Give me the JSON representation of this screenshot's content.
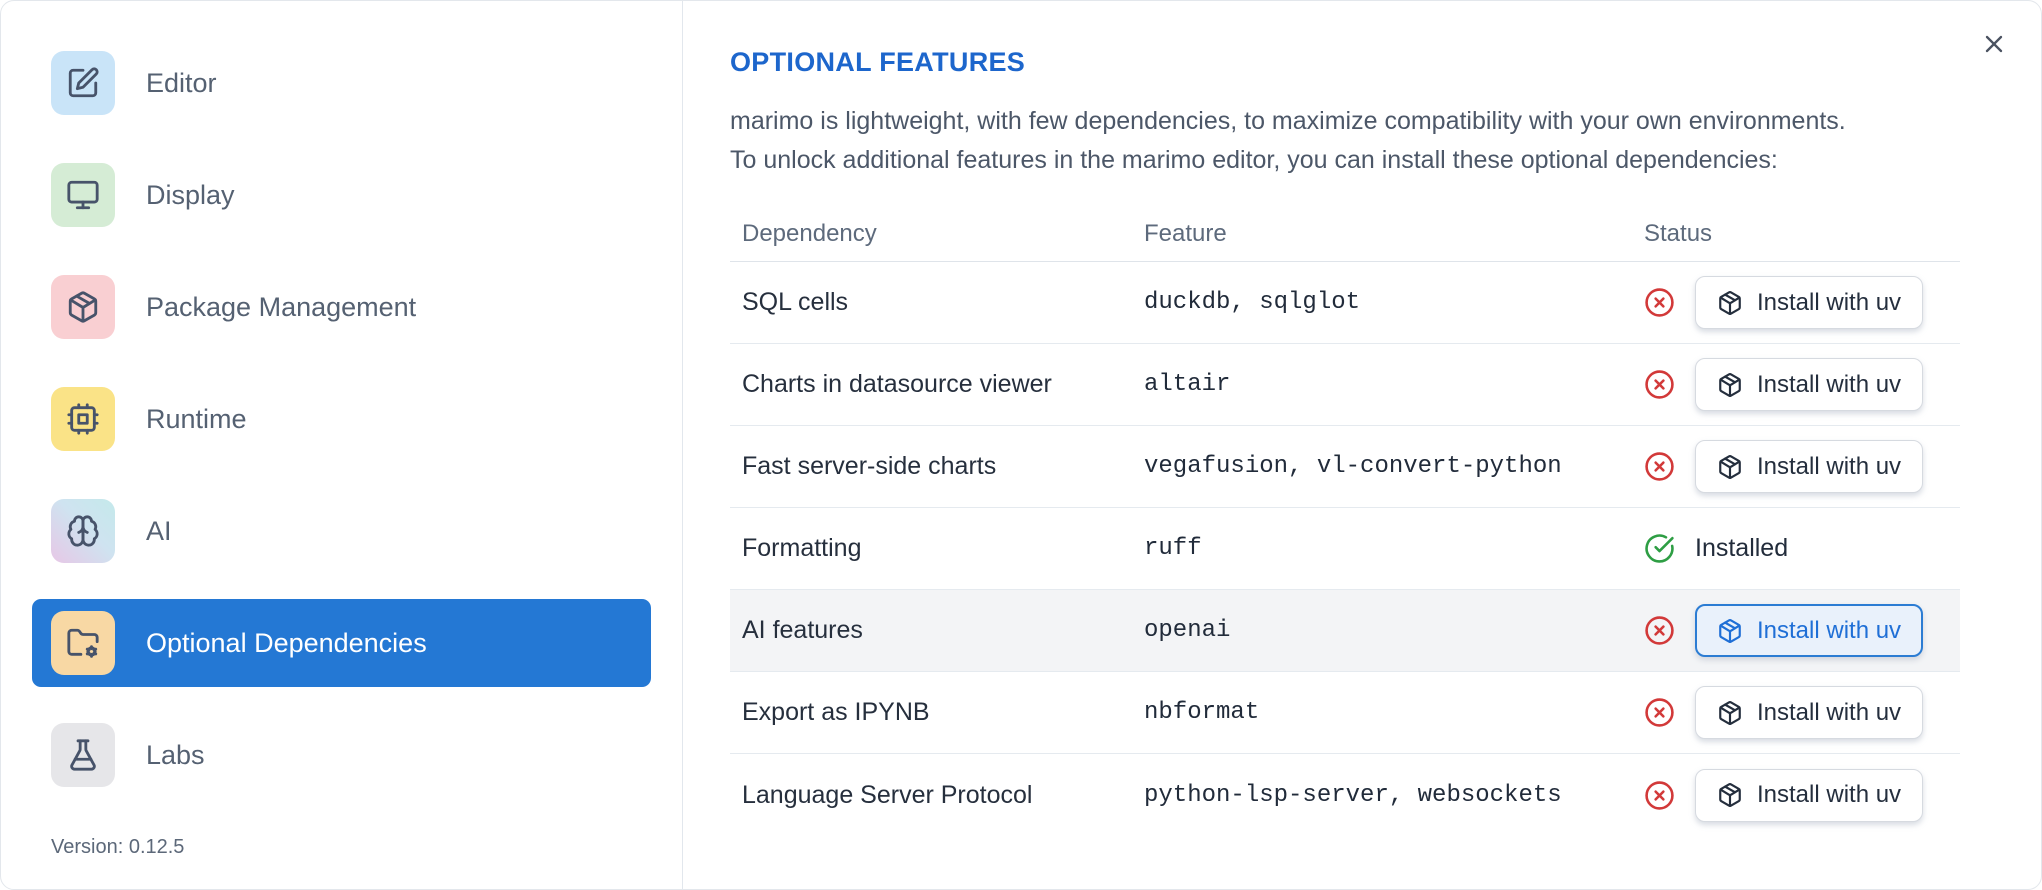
{
  "colors": {
    "accent": "#2478d4",
    "title": "#1d66cc",
    "danger": "#d23939",
    "success": "#2e9e44",
    "focus_border": "#2b7cd3",
    "focus_text": "#1f6fd6",
    "focus_bg": "#e9f1fb",
    "row_highlight": "#f3f4f6"
  },
  "sidebar": {
    "items": [
      {
        "label": "Editor",
        "icon": "square-pen-icon",
        "icon_bg": "#c9e4f8",
        "selected": false
      },
      {
        "label": "Display",
        "icon": "monitor-icon",
        "icon_bg": "#d5ecd5",
        "selected": false
      },
      {
        "label": "Package Management",
        "icon": "package-icon",
        "icon_bg": "#f9cfd2",
        "selected": false
      },
      {
        "label": "Runtime",
        "icon": "cpu-icon",
        "icon_bg": "#fae387",
        "selected": false
      },
      {
        "label": "AI",
        "icon": "brain-icon",
        "icon_bg": "linear-gradient(45deg,#e7c7e6,#cfe3f0 55%,#c4e9eb)",
        "selected": false
      },
      {
        "label": "Optional Dependencies",
        "icon": "folder-cog-icon",
        "icon_bg": "#f8d8a4",
        "selected": true
      },
      {
        "label": "Labs",
        "icon": "flask-icon",
        "icon_bg": "#e6e6e9",
        "selected": false
      }
    ],
    "version": "Version: 0.12.5"
  },
  "main": {
    "title": "OPTIONAL FEATURES",
    "description_line1": "marimo is lightweight, with few dependencies, to maximize compatibility with your own environments.",
    "description_line2": "To unlock additional features in the marimo editor, you can install these optional dependencies:",
    "table": {
      "headers": [
        "Dependency",
        "Feature",
        "Status"
      ],
      "install_button_label": "Install with uv",
      "installed_label": "Installed",
      "rows": [
        {
          "dependency": "SQL cells",
          "feature": "duckdb, sqlglot",
          "status": "missing",
          "highlighted": false
        },
        {
          "dependency": "Charts in datasource viewer",
          "feature": "altair",
          "status": "missing",
          "highlighted": false
        },
        {
          "dependency": "Fast server-side charts",
          "feature": "vegafusion, vl-convert-python",
          "status": "missing",
          "highlighted": false
        },
        {
          "dependency": "Formatting",
          "feature": "ruff",
          "status": "installed",
          "highlighted": false
        },
        {
          "dependency": "AI features",
          "feature": "openai",
          "status": "missing",
          "highlighted": true
        },
        {
          "dependency": "Export as IPYNB",
          "feature": "nbformat",
          "status": "missing",
          "highlighted": false
        },
        {
          "dependency": "Language Server Protocol",
          "feature": "python-lsp-server, websockets",
          "status": "missing",
          "highlighted": false
        }
      ]
    }
  }
}
